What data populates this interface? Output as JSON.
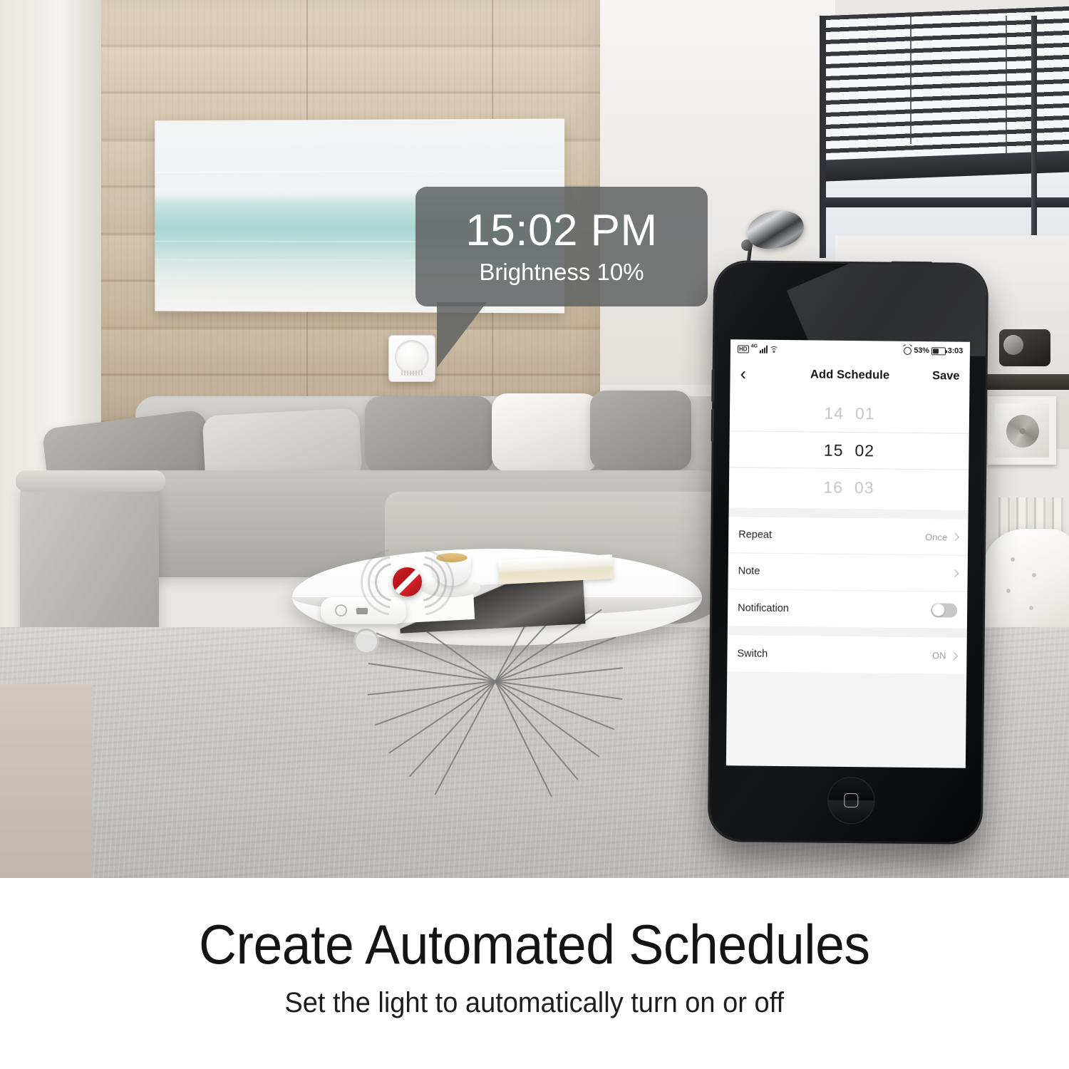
{
  "scene": {
    "alt_name": "living-room-photo",
    "bubble": {
      "time": "15:02 PM",
      "brightness": "Brightness 10%"
    },
    "devices": {
      "wall_dimmer": "wall-dimmer-switch",
      "hub": "smart-hub",
      "logo": "z-wave-logo"
    }
  },
  "phone": {
    "status_bar": {
      "hd_label": "HD",
      "network_label": "4G",
      "alarm_icon": "alarm-icon",
      "battery_percent": "53%",
      "clock": "3:03"
    },
    "nav": {
      "back_glyph": "‹",
      "title": "Add Schedule",
      "save_label": "Save"
    },
    "time_picker": {
      "rows": [
        {
          "hour": "14",
          "minute": "01",
          "selected": false
        },
        {
          "hour": "15",
          "minute": "02",
          "selected": true
        },
        {
          "hour": "16",
          "minute": "03",
          "selected": false
        }
      ]
    },
    "settings_rows": [
      {
        "label": "Repeat",
        "value": "Once",
        "control": "chevron"
      },
      {
        "label": "Note",
        "value": "",
        "control": "chevron"
      },
      {
        "label": "Notification",
        "value": "",
        "control": "toggle-off"
      }
    ],
    "switch_row": {
      "label": "Switch",
      "value": "ON",
      "control": "chevron"
    }
  },
  "caption": {
    "title": "Create Automated Schedules",
    "subtitle": "Set the light to automatically turn on or off"
  },
  "colors": {
    "bubble_bg": "#606363",
    "accent_red": "#d42027",
    "text_dark": "#141414",
    "text_muted": "#9b9b9b"
  }
}
